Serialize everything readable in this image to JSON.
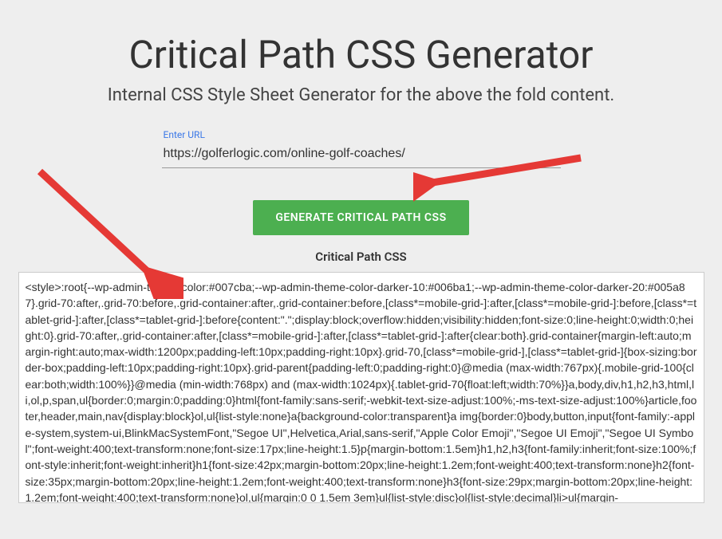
{
  "header": {
    "title": "Critical Path CSS Generator",
    "subtitle": "Internal CSS Style Sheet Generator for the above the fold content."
  },
  "form": {
    "url_label": "Enter URL",
    "url_value": "https://golferlogic.com/online-golf-coaches/",
    "button_label": "GENERATE CRITICAL PATH CSS"
  },
  "output": {
    "label": "Critical Path CSS",
    "content": "<style>:root{--wp-admin-theme-color:#007cba;--wp-admin-theme-color-darker-10:#006ba1;--wp-admin-theme-color-darker-20:#005a87}.grid-70:after,.grid-70:before,.grid-container:after,.grid-container:before,[class*=mobile-grid-]:after,[class*=mobile-grid-]:before,[class*=tablet-grid-]:after,[class*=tablet-grid-]:before{content:\".\";display:block;overflow:hidden;visibility:hidden;font-size:0;line-height:0;width:0;height:0}.grid-70:after,.grid-container:after,[class*=mobile-grid-]:after,[class*=tablet-grid-]:after{clear:both}.grid-container{margin-left:auto;margin-right:auto;max-width:1200px;padding-left:10px;padding-right:10px}.grid-70,[class*=mobile-grid-],[class*=tablet-grid-]{box-sizing:border-box;padding-left:10px;padding-right:10px}.grid-parent{padding-left:0;padding-right:0}@media (max-width:767px){.mobile-grid-100{clear:both;width:100%}}@media (min-width:768px) and (max-width:1024px){.tablet-grid-70{float:left;width:70%}}a,body,div,h1,h2,h3,html,li,ol,p,span,ul{border:0;margin:0;padding:0}html{font-family:sans-serif;-webkit-text-size-adjust:100%;-ms-text-size-adjust:100%}article,footer,header,main,nav{display:block}ol,ul{list-style:none}a{background-color:transparent}a img{border:0}body,button,input{font-family:-apple-system,system-ui,BlinkMacSystemFont,\"Segoe UI\",Helvetica,Arial,sans-serif,\"Apple Color Emoji\",\"Segoe UI Emoji\",\"Segoe UI Symbol\";font-weight:400;text-transform:none;font-size:17px;line-height:1.5}p{margin-bottom:1.5em}h1,h2,h3{font-family:inherit;font-size:100%;font-style:inherit;font-weight:inherit}h1{font-size:42px;margin-bottom:20px;line-height:1.2em;font-weight:400;text-transform:none}h2{font-size:35px;margin-bottom:20px;line-height:1.2em;font-weight:400;text-transform:none}h3{font-size:29px;margin-bottom:20px;line-height:1.2em;font-weight:400;text-transform:none}ol,ul{margin:0 0 1.5em 3em}ul{list-style:disc}ol{list-style:decimal}li>ul{margin-"
  }
}
